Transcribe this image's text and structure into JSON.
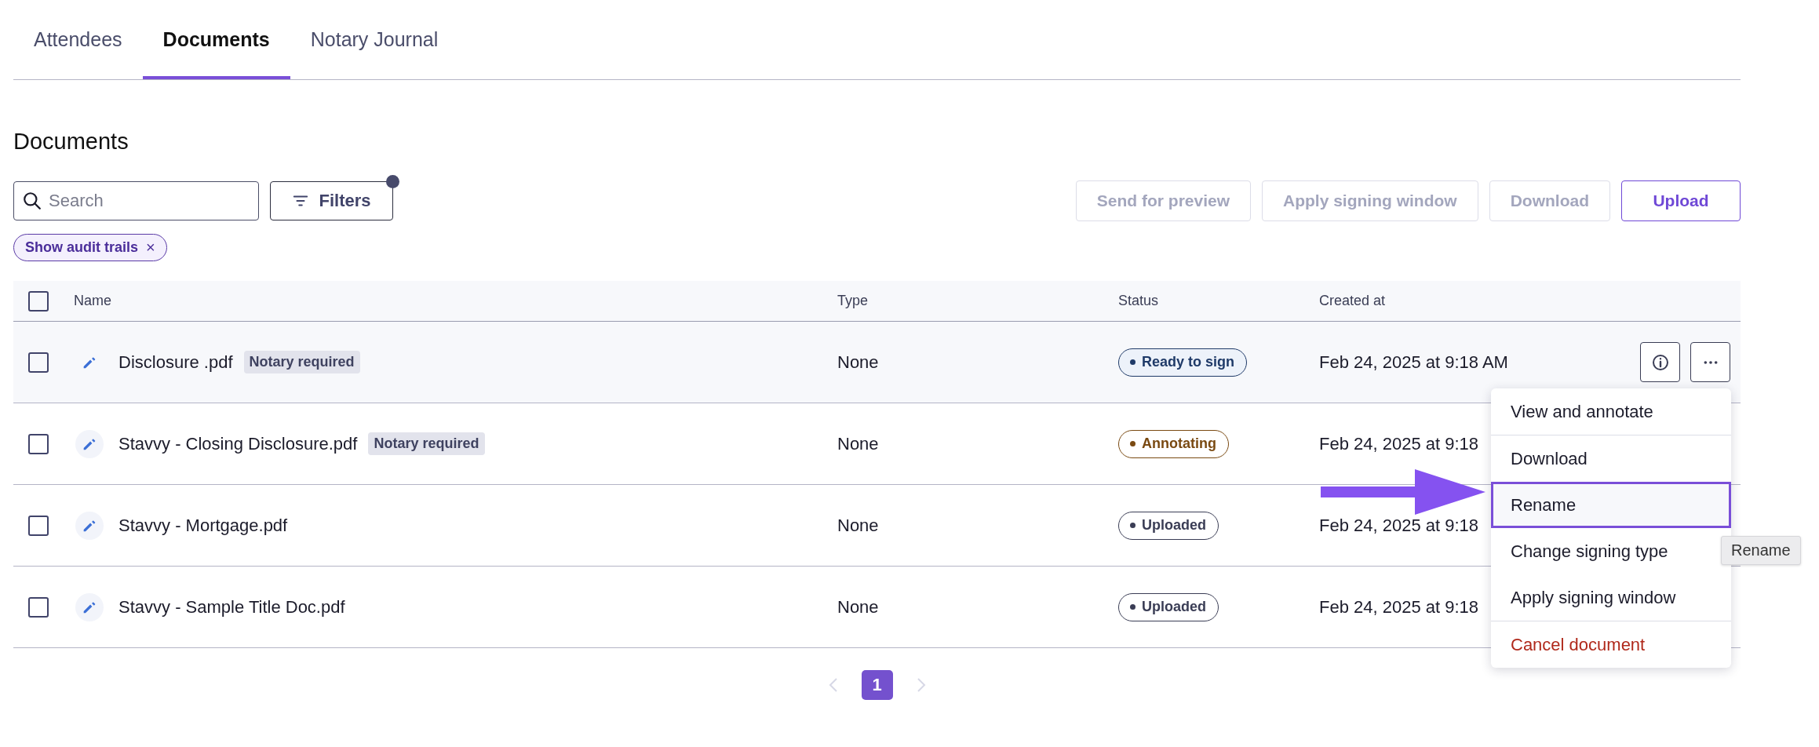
{
  "tabs": [
    {
      "label": "Attendees",
      "selected": false
    },
    {
      "label": "Documents",
      "selected": true
    },
    {
      "label": "Notary Journal",
      "selected": false
    }
  ],
  "heading": "Documents",
  "search": {
    "placeholder": "Search"
  },
  "filters_button": {
    "label": "Filters",
    "active_dot": true
  },
  "toolbar_buttons": [
    {
      "label": "Send for preview",
      "disabled": true
    },
    {
      "label": "Apply signing window",
      "disabled": true
    },
    {
      "label": "Download",
      "disabled": true
    },
    {
      "label": "Upload",
      "disabled": false
    }
  ],
  "filter_chips": [
    {
      "label": "Show audit trails",
      "remove": "×"
    }
  ],
  "table": {
    "select_all_checked": false,
    "columns": [
      "Name",
      "Type",
      "Status",
      "Created at"
    ],
    "rows": [
      {
        "checked": false,
        "hovered": true,
        "name": "Disclosure .pdf",
        "tag": "Notary required",
        "type": "None",
        "status": {
          "label": "Ready to sign",
          "color": "#1f3a68"
        },
        "created": "Feb 24, 2025 at 9:18 AM"
      },
      {
        "checked": false,
        "hovered": false,
        "name": "Stavvy - Closing Disclosure.pdf",
        "tag": "Notary required",
        "type": "None",
        "status": {
          "label": "Annotating",
          "color": "#7a4a12"
        },
        "created": "Feb 24, 2025 at 9:18"
      },
      {
        "checked": false,
        "hovered": false,
        "name": "Stavvy - Mortgage.pdf",
        "type": "None",
        "status": {
          "label": "Uploaded",
          "color": "#3a3d55"
        },
        "created": "Feb 24, 2025 at 9:18"
      },
      {
        "checked": false,
        "hovered": false,
        "name": "Stavvy - Sample Title Doc.pdf",
        "type": "None",
        "status": {
          "label": "Uploaded",
          "color": "#3a3d55"
        },
        "created": "Feb 24, 2025 at 9:18"
      }
    ]
  },
  "row_menu": {
    "sections": [
      [
        {
          "label": "View and annotate",
          "selected": false,
          "kind": "normal"
        }
      ],
      [
        {
          "label": "Download",
          "selected": false,
          "kind": "normal"
        },
        {
          "label": "Rename",
          "selected": true,
          "kind": "normal"
        },
        {
          "label": "Change signing type",
          "selected": false,
          "kind": "normal"
        },
        {
          "label": "Apply signing window",
          "selected": false,
          "kind": "normal"
        }
      ],
      [
        {
          "label": "Cancel document",
          "selected": false,
          "kind": "danger"
        }
      ]
    ]
  },
  "tooltip": "Rename",
  "pagination": {
    "prev_disabled": true,
    "next_disabled": true,
    "pages": [
      {
        "label": "1",
        "selected": true
      }
    ]
  }
}
